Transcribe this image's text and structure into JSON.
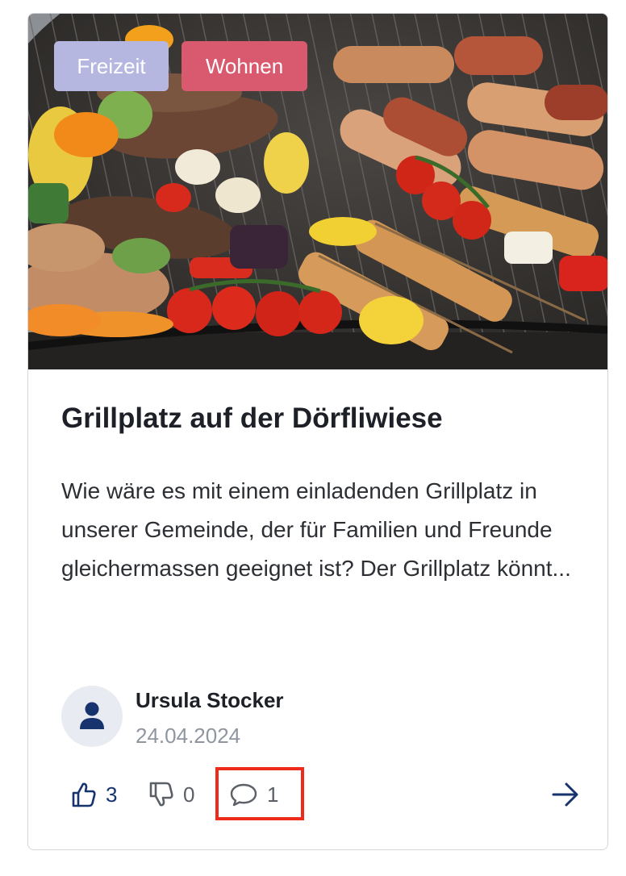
{
  "card": {
    "image_alt": "Grilled meat, sausages, vegetables and skewers on a grill",
    "tags": [
      {
        "label": "Freizeit",
        "color": "#b6b7e0"
      },
      {
        "label": "Wohnen",
        "color": "#d9596e"
      }
    ],
    "title": "Grillplatz auf der Dörfliwiese",
    "description": "Wie wäre es mit einem einladenden Grillplatz in unserer Gemeinde, der für Familien und Freunde gleichermassen geeignet ist? Der Grillplatz könnt...",
    "author": {
      "name": "Ursula Stocker",
      "date": "24.04.2024",
      "avatar_icon": "user-icon"
    },
    "actions": {
      "likes": "3",
      "dislikes": "0",
      "comments": "1",
      "like_icon": "thumbs-up-icon",
      "dislike_icon": "thumbs-down-icon",
      "comment_icon": "speech-bubble-icon",
      "open_icon": "arrow-right-icon"
    },
    "colors": {
      "primary": "#16336e",
      "highlight": "#ee2a1b"
    }
  }
}
